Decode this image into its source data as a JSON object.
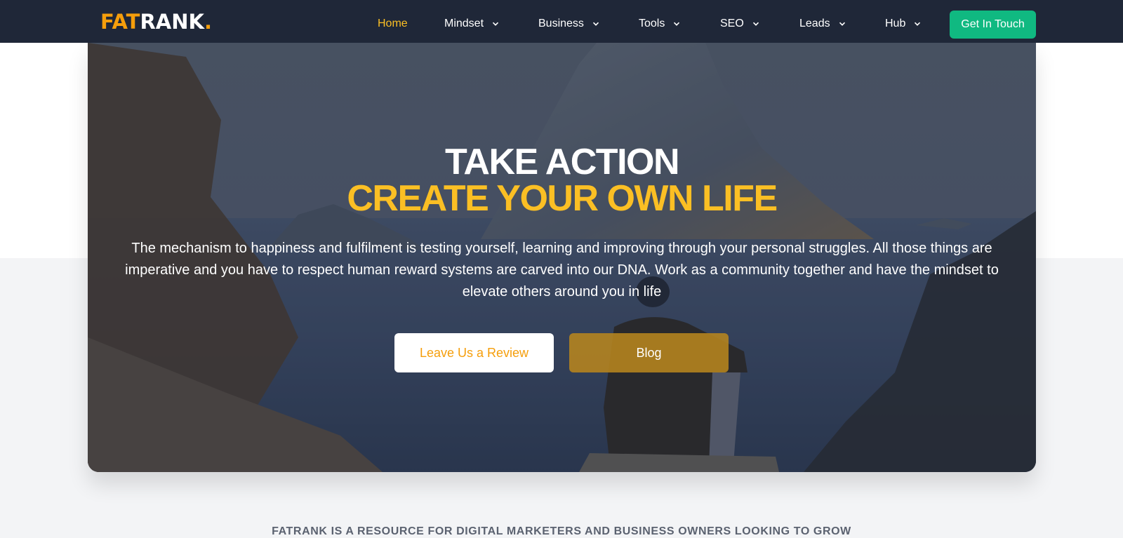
{
  "header": {
    "logo": {
      "part1": "FAT",
      "part2": "RANK",
      "part3": "."
    },
    "nav": [
      {
        "label": "Home",
        "active": true,
        "has_dropdown": false
      },
      {
        "label": "Mindset",
        "active": false,
        "has_dropdown": true
      },
      {
        "label": "Business",
        "active": false,
        "has_dropdown": true
      },
      {
        "label": "Tools",
        "active": false,
        "has_dropdown": true
      },
      {
        "label": "SEO",
        "active": false,
        "has_dropdown": true
      },
      {
        "label": "Leads",
        "active": false,
        "has_dropdown": true
      },
      {
        "label": "Hub",
        "active": false,
        "has_dropdown": true
      }
    ],
    "cta_label": "Get In Touch"
  },
  "hero": {
    "title_line1": "TAKE ACTION",
    "title_line2": "CREATE YOUR OWN LIFE",
    "body": "The mechanism to happiness and fulfilment is testing yourself, learning and improving through your personal struggles. All those things are imperative and you have to respect human reward systems are carved into our DNA. Work as a community together and have the mindset to elevate others around you in life",
    "primary_button": "Leave Us a Review",
    "secondary_button": "Blog",
    "image_icon": "hero-landscape-photo"
  },
  "tagline": "FATRANK IS A RESOURCE FOR DIGITAL MARKETERS AND BUSINESS OWNERS LOOKING TO GROW",
  "colors": {
    "header_bg": "#1f2738",
    "accent_orange": "#f59e0b",
    "accent_yellow": "#fbbf24",
    "cta_green": "#10b981",
    "blog_button": "#b7851e",
    "tagline_text": "#5b6270",
    "page_bg_lower": "#f3f4f6"
  }
}
